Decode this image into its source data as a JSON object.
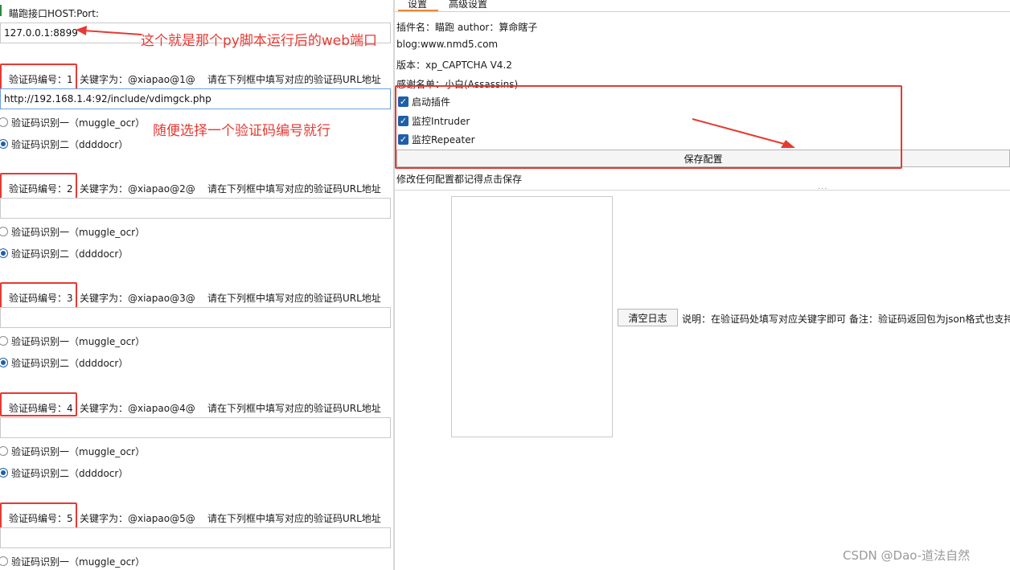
{
  "left": {
    "host_label": "瞄跑接口HOST:Port:",
    "host_value": "127.0.0.1:8899",
    "host_annotation": "这个就是那个py脚本运行后的web端口",
    "select_annotation": "随便选择一个验证码编号就行",
    "captchas": [
      {
        "label": "验证码编号：1",
        "keyword": "关键字为：@xiapao@1@",
        "hint": "请在下列框中填写对应的验证码URL地址",
        "url": "http://192.168.1.4:92/include/vdimgck.php",
        "option1": "验证码识别一（muggle_ocr）",
        "option2": "验证码识别二（ddddocr）",
        "selected": 2
      },
      {
        "label": "验证码编号：2",
        "keyword": "关键字为：@xiapao@2@",
        "hint": "请在下列框中填写对应的验证码URL地址",
        "url": "",
        "option1": "验证码识别一（muggle_ocr）",
        "option2": "验证码识别二（ddddocr）",
        "selected": 2
      },
      {
        "label": "验证码编号：3",
        "keyword": "关键字为：@xiapao@3@",
        "hint": "请在下列框中填写对应的验证码URL地址",
        "url": "",
        "option1": "验证码识别一（muggle_ocr）",
        "option2": "验证码识别二（ddddocr）",
        "selected": 2
      },
      {
        "label": "验证码编号：4",
        "keyword": "关键字为：@xiapao@4@",
        "hint": "请在下列框中填写对应的验证码URL地址",
        "url": "",
        "option1": "验证码识别一（muggle_ocr）",
        "option2": "验证码识别二（ddddocr）",
        "selected": 2
      },
      {
        "label": "验证码编号：5",
        "keyword": "关键字为：@xiapao@5@",
        "hint": "请在下列框中填写对应的验证码URL地址",
        "url": "",
        "option1": "验证码识别一（muggle_ocr）",
        "option2": "",
        "selected": 0
      }
    ]
  },
  "right": {
    "tabs": [
      "设置",
      "高级设置"
    ],
    "plugin_name": "插件名：瞄跑 author：算命瞎子",
    "blog": "blog:www.nmd5.com",
    "version": "版本：xp_CAPTCHA V4.2",
    "thanks": "感谢名单：小白(Assassins)",
    "checks": [
      "启动插件",
      "监控Intruder",
      "监控Repeater"
    ],
    "save_button": "保存配置",
    "save_hint": "修改任何配置都记得点击保存",
    "clear_button": "清空日志",
    "note": "说明：在验证码处填写对应关键字即可 备注：验证码返回包为json格式也支持"
  },
  "watermark": "CSDN @Dao-道法自然",
  "colors": {
    "annotation_red": "#e53a33",
    "accent_blue": "#1e5fa8"
  }
}
